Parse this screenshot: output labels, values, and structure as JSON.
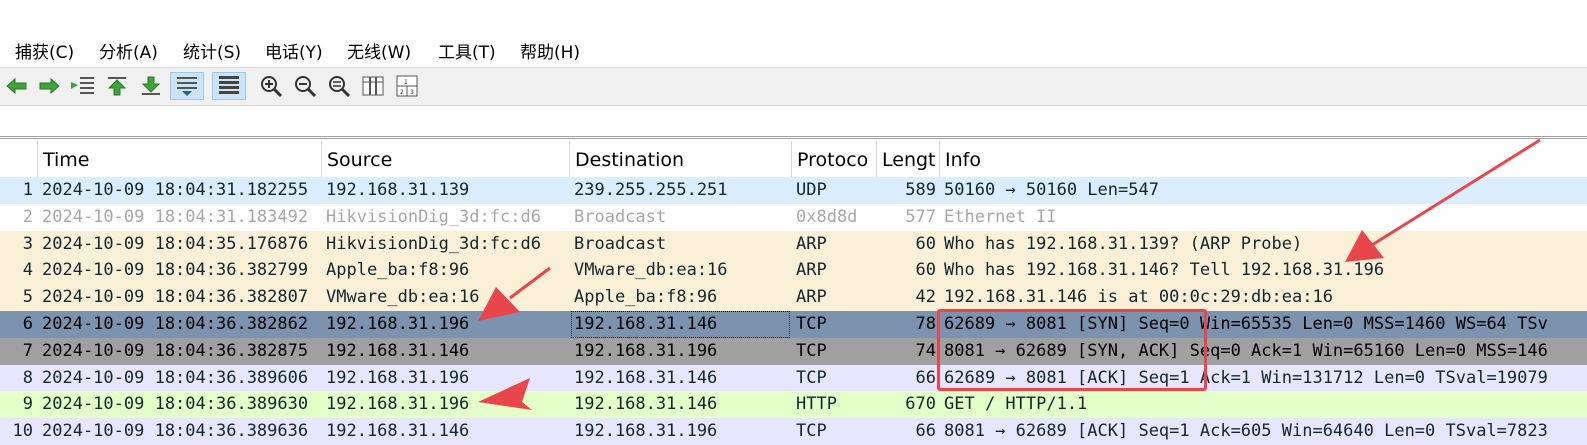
{
  "menu": [
    {
      "label": "捕获(C)"
    },
    {
      "label": "分析(A)"
    },
    {
      "label": "统计(S)"
    },
    {
      "label": "电话(Y)"
    },
    {
      "label": "无线(W)"
    },
    {
      "label": "工具(T)"
    },
    {
      "label": "帮助(H)"
    }
  ],
  "toolbar": {
    "icons": [
      "go-back-icon",
      "go-forward-icon",
      "go-to-packet-icon",
      "first-packet-icon",
      "last-packet-icon",
      "autoscroll-icon",
      "colorize-icon",
      "zoom-in-icon",
      "zoom-out-icon",
      "zoom-normal-icon",
      "resize-columns-icon",
      "layout-icon"
    ]
  },
  "columns": [
    "Time",
    "Source",
    "Destination",
    "Protoco",
    "Lengt",
    "Info"
  ],
  "packets": [
    {
      "no": "1",
      "time": "2024-10-09 18:04:31.182255",
      "src": "192.168.31.139",
      "dst": "239.255.255.251",
      "proto": "UDP",
      "len": "589",
      "info": "50160 → 50160 Len=547",
      "bg": "#daeeff",
      "fg": "#12272e"
    },
    {
      "no": "2",
      "time": "2024-10-09 18:04:31.183492",
      "src": "HikvisionDig_3d:fc:d6",
      "dst": "Broadcast",
      "proto": "0x8d8d",
      "len": "577",
      "info": "Ethernet II",
      "bg": "#ffffff",
      "fg": "#a8a8a8"
    },
    {
      "no": "3",
      "time": "2024-10-09 18:04:35.176876",
      "src": "HikvisionDig_3d:fc:d6",
      "dst": "Broadcast",
      "proto": "ARP",
      "len": "60",
      "info": "Who has 192.168.31.139? (ARP Probe)",
      "bg": "#faf0d7",
      "fg": "#12272e"
    },
    {
      "no": "4",
      "time": "2024-10-09 18:04:36.382799",
      "src": "Apple_ba:f8:96",
      "dst": "VMware_db:ea:16",
      "proto": "ARP",
      "len": "60",
      "info": "Who has 192.168.31.146? Tell 192.168.31.196",
      "bg": "#faf0d7",
      "fg": "#12272e"
    },
    {
      "no": "5",
      "time": "2024-10-09 18:04:36.382807",
      "src": "VMware_db:ea:16",
      "dst": "Apple_ba:f8:96",
      "proto": "ARP",
      "len": "42",
      "info": "192.168.31.146 is at 00:0c:29:db:ea:16",
      "bg": "#faf0d7",
      "fg": "#12272e"
    },
    {
      "no": "6",
      "time": "2024-10-09 18:04:36.382862",
      "src": "192.168.31.196",
      "dst": "192.168.31.146",
      "proto": "TCP",
      "len": "78",
      "info": "62689 → 8081 [SYN] Seq=0 Win=65535 Len=0 MSS=1460 WS=64 TSv",
      "bg": "#7b93ae",
      "fg": "#000000"
    },
    {
      "no": "7",
      "time": "2024-10-09 18:04:36.382875",
      "src": "192.168.31.146",
      "dst": "192.168.31.196",
      "proto": "TCP",
      "len": "74",
      "info": "8081 → 62689 [SYN, ACK] Seq=0 Ack=1 Win=65160 Len=0 MSS=146",
      "bg": "#a0a0a0",
      "fg": "#000000"
    },
    {
      "no": "8",
      "time": "2024-10-09 18:04:36.389606",
      "src": "192.168.31.196",
      "dst": "192.168.31.146",
      "proto": "TCP",
      "len": "66",
      "info": "62689 → 8081 [ACK] Seq=1 Ack=1 Win=131712 Len=0 TSval=19079",
      "bg": "#e7e6ff",
      "fg": "#12272e"
    },
    {
      "no": "9",
      "time": "2024-10-09 18:04:36.389630",
      "src": "192.168.31.196",
      "dst": "192.168.31.146",
      "proto": "HTTP",
      "len": "670",
      "info": "GET / HTTP/1.1",
      "bg": "#e4ffc7",
      "fg": "#12272e"
    },
    {
      "no": "10",
      "time": "2024-10-09 18:04:36.389636",
      "src": "192.168.31.146",
      "dst": "192.168.31.196",
      "proto": "TCP",
      "len": "66",
      "info": "8081 → 62689 [ACK] Seq=1 Ack=605 Win=64640 Len=0 TSval=7823",
      "bg": "#e7e6ff",
      "fg": "#12272e"
    }
  ],
  "colors": {
    "annotation": "#e8464b",
    "selected_row": "#7b93ae"
  }
}
